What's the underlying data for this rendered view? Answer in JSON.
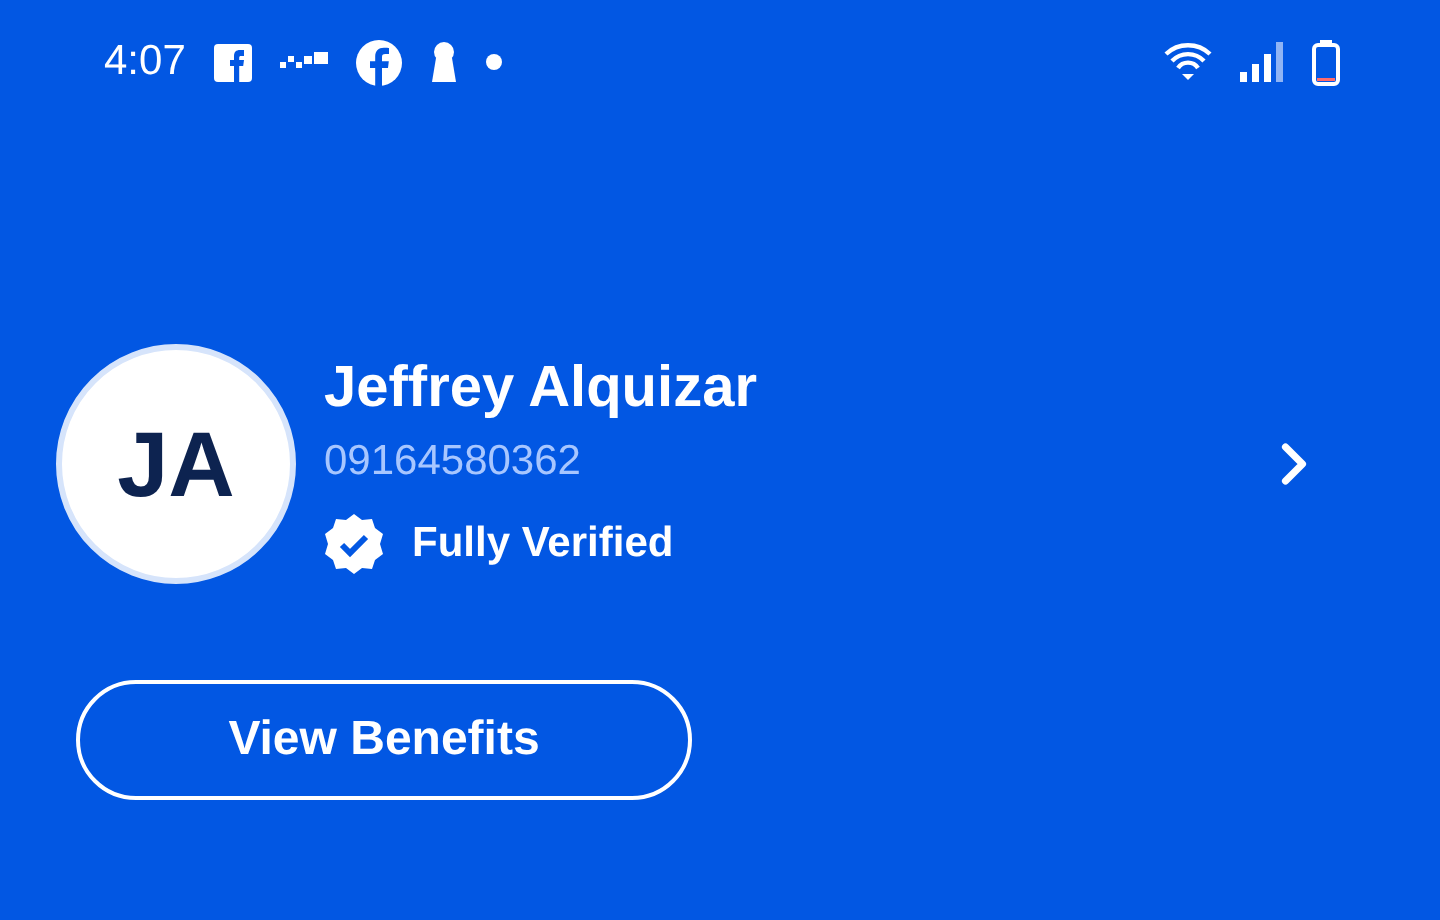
{
  "status_bar": {
    "time": "4:07"
  },
  "profile": {
    "initials": "JA",
    "name": "Jeffrey Alquizar",
    "phone": "09164580362",
    "verification": "Fully Verified"
  },
  "button": {
    "label": "View Benefits"
  }
}
